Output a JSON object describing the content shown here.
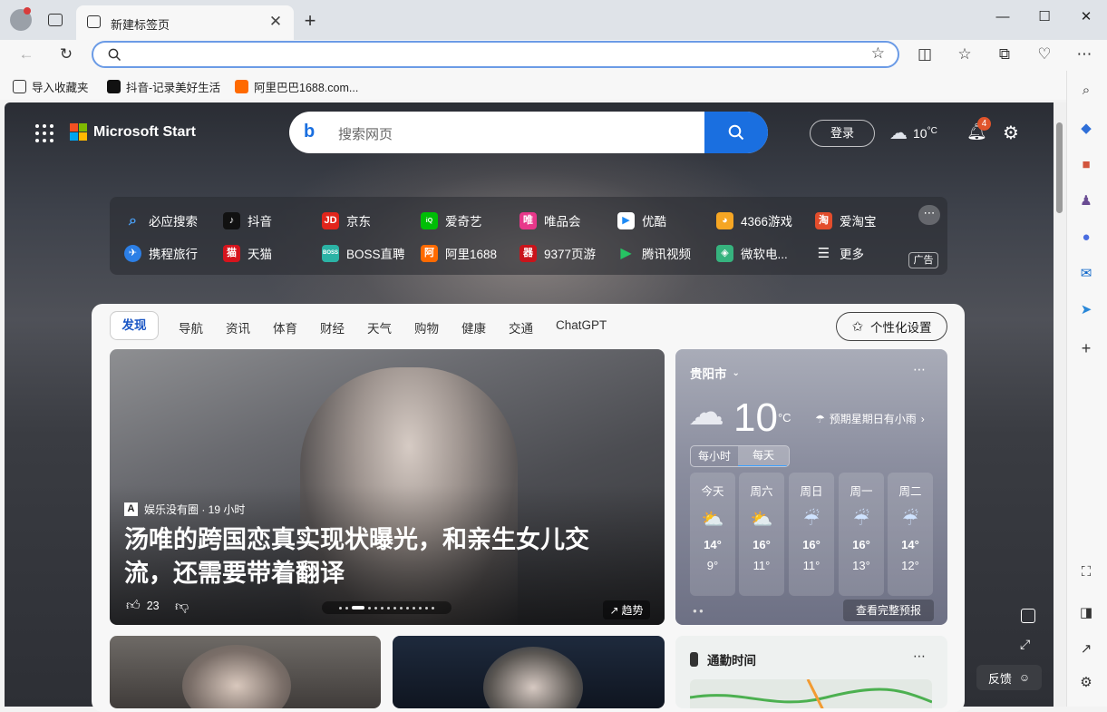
{
  "browser": {
    "tab_title": "新建标签页",
    "address_value": "",
    "bookmarks": [
      "导入收藏夹",
      "抖音-记录美好生活",
      "阿里巴巴1688.com..."
    ]
  },
  "msn": {
    "brand": "Microsoft Start",
    "search_placeholder": "搜索网页",
    "login": "登录",
    "weather_temp": "10",
    "weather_unit": "°C",
    "notification_count": "4",
    "quicklinks": [
      "必应搜索",
      "抖音",
      "京东",
      "爱奇艺",
      "唯品会",
      "优酷",
      "4366游戏",
      "爱淘宝",
      "携程旅行",
      "天猫",
      "BOSS直聘",
      "阿里1688",
      "9377页游",
      "腾讯视频",
      "微软电...",
      "更多"
    ],
    "ad_label": "广告",
    "tabs": [
      "发现",
      "导航",
      "资讯",
      "体育",
      "财经",
      "天气",
      "购物",
      "健康",
      "交通",
      "ChatGPT"
    ],
    "personalize": "个性化设置",
    "hero": {
      "source": "娱乐没有圈 · 19 小时",
      "source_badge": "A",
      "headline": "汤唯的跨国恋真实现状曝光，和亲生女儿交流，还需要带着翻译",
      "likes": "23",
      "trend": "趋势"
    },
    "weather_card": {
      "city": "贵阳市",
      "temp": "10",
      "unit": "°C",
      "forecast_note": "预期星期日有小雨",
      "toggle": [
        "每小时",
        "每天"
      ],
      "days": [
        {
          "day": "今天",
          "high": "14°",
          "low": "9°"
        },
        {
          "day": "周六",
          "high": "16°",
          "low": "11°"
        },
        {
          "day": "周日",
          "high": "16°",
          "low": "11°"
        },
        {
          "day": "周一",
          "high": "16°",
          "low": "13°"
        },
        {
          "day": "周二",
          "high": "14°",
          "low": "12°"
        }
      ],
      "full_forecast": "查看完整预报"
    },
    "traffic_title": "通勤时间",
    "feedback": "反馈"
  },
  "colors": {
    "accent": "#1a6fe0",
    "notify": "#e0542b"
  }
}
